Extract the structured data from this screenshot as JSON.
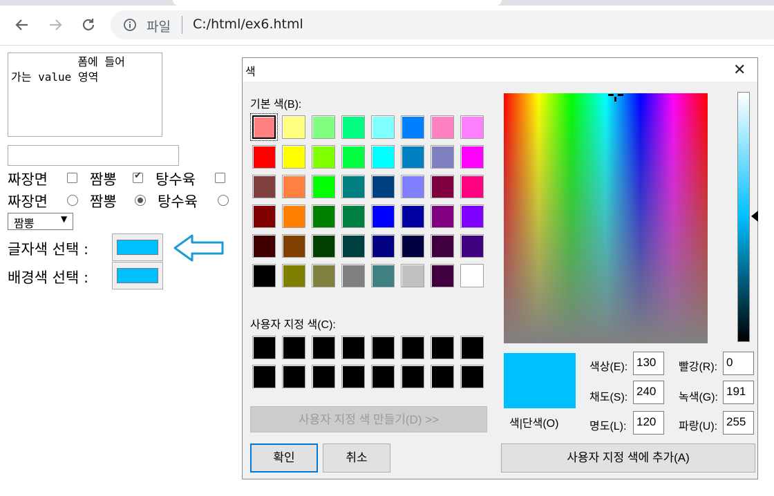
{
  "browser": {
    "scheme_label": "파일",
    "url": "C:/html/ex6.html"
  },
  "form": {
    "textarea_value": "          폼에 들어\n가는 value 영역",
    "text_input_value": "",
    "checkbox_row": [
      {
        "label": "짜장면",
        "checked": false
      },
      {
        "label": "짬뽕",
        "checked": true
      },
      {
        "label": "탕수육",
        "checked": false
      }
    ],
    "radio_row": [
      {
        "label": "짜장면",
        "checked": false
      },
      {
        "label": "짬뽕",
        "checked": true
      },
      {
        "label": "탕수육",
        "checked": false
      }
    ],
    "select_value": "짬뽕",
    "text_color_label": "글자색 선택 :",
    "bg_color_label": "배경색 선택 :",
    "text_color_value": "#00bfff",
    "bg_color_value": "#00bfff",
    "arrow_color": "#1a9ad6"
  },
  "dialog": {
    "title": "색",
    "basic_colors_label": "기본 색(B):",
    "basic_colors": [
      "#ff8080",
      "#ffff80",
      "#80ff80",
      "#00ff80",
      "#80ffff",
      "#0080ff",
      "#ff80c0",
      "#ff80ff",
      "#ff0000",
      "#ffff00",
      "#80ff00",
      "#00ff40",
      "#00ffff",
      "#0080c0",
      "#8080c0",
      "#ff00ff",
      "#804040",
      "#ff8040",
      "#00ff00",
      "#008080",
      "#004080",
      "#8080ff",
      "#800040",
      "#ff0080",
      "#800000",
      "#ff8000",
      "#008000",
      "#008040",
      "#0000ff",
      "#0000a0",
      "#800080",
      "#8000ff",
      "#400000",
      "#804000",
      "#004000",
      "#004040",
      "#000080",
      "#000040",
      "#400040",
      "#400080",
      "#000000",
      "#808000",
      "#808040",
      "#808080",
      "#408080",
      "#c0c0c0",
      "#400040",
      "#ffffff"
    ],
    "custom_colors_label": "사용자 지정 색(C):",
    "custom_colors": [
      "#000000",
      "#000000",
      "#000000",
      "#000000",
      "#000000",
      "#000000",
      "#000000",
      "#000000",
      "#000000",
      "#000000",
      "#000000",
      "#000000",
      "#000000",
      "#000000",
      "#000000",
      "#000000"
    ],
    "define_custom_button": "사용자 지정 색 만들기(D) >>",
    "ok_button": "확인",
    "cancel_button": "취소",
    "add_custom_button": "사용자 지정 색에 추가(A)",
    "preview_label": "색|단색(O)",
    "preview_color": "#00bfff",
    "hue_label": "색상(E):",
    "hue_value": "130",
    "sat_label": "채도(S):",
    "sat_value": "240",
    "lum_label": "명도(L):",
    "lum_value": "120",
    "red_label": "빨강(R):",
    "red_value": "0",
    "green_label": "녹색(G):",
    "green_value": "191",
    "blue_label": "파랑(U):",
    "blue_value": "255"
  }
}
